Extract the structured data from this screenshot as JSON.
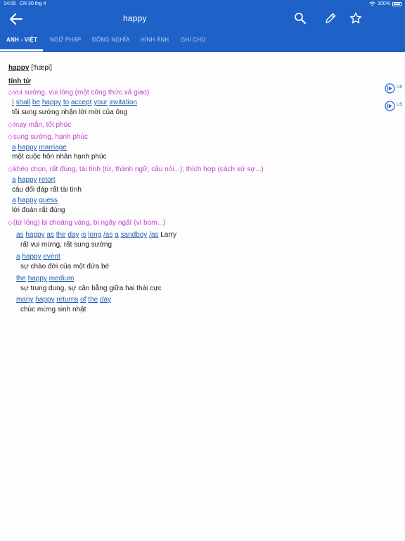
{
  "status_bar": {
    "time": "14:09",
    "date": "CN 30 thg 4",
    "battery": "100%"
  },
  "header": {
    "title": "happy",
    "icons": [
      "back-arrow-icon",
      "search-icon",
      "pencil-icon",
      "star-icon"
    ]
  },
  "tabs": [
    {
      "label": "ANH - VIỆT",
      "active": true
    },
    {
      "label": "NGỮ PHÁP",
      "active": false
    },
    {
      "label": "ĐỒNG NGHĨA",
      "active": false
    },
    {
      "label": "HÌNH ẢNH",
      "active": false
    },
    {
      "label": "GHI CHÚ",
      "active": false
    }
  ],
  "entry": {
    "headword": "happy",
    "pronunciation": "['hæpi]",
    "part_of_speech": "tính từ",
    "audio": [
      {
        "label": "UK"
      },
      {
        "label": "US"
      }
    ],
    "senses": [
      {
        "meaning": "vui sướng, vui lòng (một công thức xã giao)",
        "examples": [
          {
            "words": [
              "I",
              "shall",
              "be",
              "happy",
              "to",
              "accept",
              "your",
              "invitation"
            ],
            "translation": "tôi sung sướng nhận lời mời của ông"
          }
        ]
      },
      {
        "meaning": "may mắn, tốt phúc",
        "examples": []
      },
      {
        "meaning": "sung sướng, hạnh phúc",
        "examples": [
          {
            "words": [
              "a",
              "happy",
              "marriage"
            ],
            "translation": "một cuộc hôn nhân hạnh phúc"
          }
        ]
      },
      {
        "meaning": "khéo chọn, rất đúng, tài tình (từ, thành ngữ, câu nói...); thích hợp (cách xử sự...)",
        "examples": [
          {
            "words": [
              "a",
              "happy",
              "retort"
            ],
            "translation": "câu đối đáp rất tài tình"
          },
          {
            "words": [
              "a",
              "happy",
              "guess"
            ],
            "translation": "lời đoán rất đúng"
          }
        ]
      },
      {
        "meaning": "(từ lóng) bị choáng váng, bị ngây ngất (vì bom...)",
        "examples": []
      }
    ],
    "idioms": [
      {
        "words": [
          "as",
          "happy",
          "as",
          "the",
          "day",
          "is",
          "long",
          "/as",
          "a",
          "sandboy",
          "/as"
        ],
        "plain": "Larry",
        "translation": "rất vui mừng, rất sung sướng"
      },
      {
        "words": [
          "a",
          "happy",
          "event"
        ],
        "plain": "",
        "translation": "sự chào đời của một đứa bé"
      },
      {
        "words": [
          "the",
          "happy",
          "medium"
        ],
        "plain": "",
        "translation": "sự trung dung, sự cân bằng giữa hai thái cực"
      },
      {
        "words": [
          "many",
          "happy",
          "returns",
          "of",
          "the",
          "day"
        ],
        "plain": "",
        "translation": "chúc mừng sinh nhật"
      }
    ]
  },
  "colors": {
    "header_bg": "#1e62c8",
    "sense": "#c23fcf",
    "example_link": "#1f5fb0"
  }
}
